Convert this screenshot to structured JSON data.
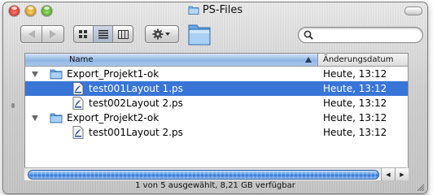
{
  "window": {
    "title": "PS-Files"
  },
  "toolbar": {
    "back_label": "back",
    "forward_label": "forward",
    "view_modes": [
      "icon-view",
      "list-view",
      "column-view"
    ],
    "selected_view": "list-view",
    "action_menu_icon": "gear-icon",
    "search_placeholder": ""
  },
  "list": {
    "columns": {
      "name": "Name",
      "date": "Änderungsdatum"
    },
    "rows": [
      {
        "name": "Export_Projekt1-ok",
        "date": "Heute, 13:12",
        "type": "folder",
        "level": 0,
        "expanded": true,
        "selected": false
      },
      {
        "name": "test001Layout 1.ps",
        "date": "Heute, 13:12",
        "type": "ps-file",
        "level": 1,
        "selected": true
      },
      {
        "name": "test002Layout 2.ps",
        "date": "Heute, 13:12",
        "type": "ps-file",
        "level": 1,
        "selected": false
      },
      {
        "name": "Export_Projekt2-ok",
        "date": "Heute, 13:12",
        "type": "folder",
        "level": 0,
        "expanded": true,
        "selected": false
      },
      {
        "name": "test001Layout 2.ps",
        "date": "Heute, 13:12",
        "type": "ps-file",
        "level": 1,
        "selected": false
      }
    ]
  },
  "status_bar": {
    "text": "1 von 5 ausgewählt, 8,21 GB verfügbar"
  },
  "colors": {
    "selection": "#3875d7",
    "header_sorted": "#8fb6e4",
    "scroll_thumb": "#2f73d3"
  }
}
